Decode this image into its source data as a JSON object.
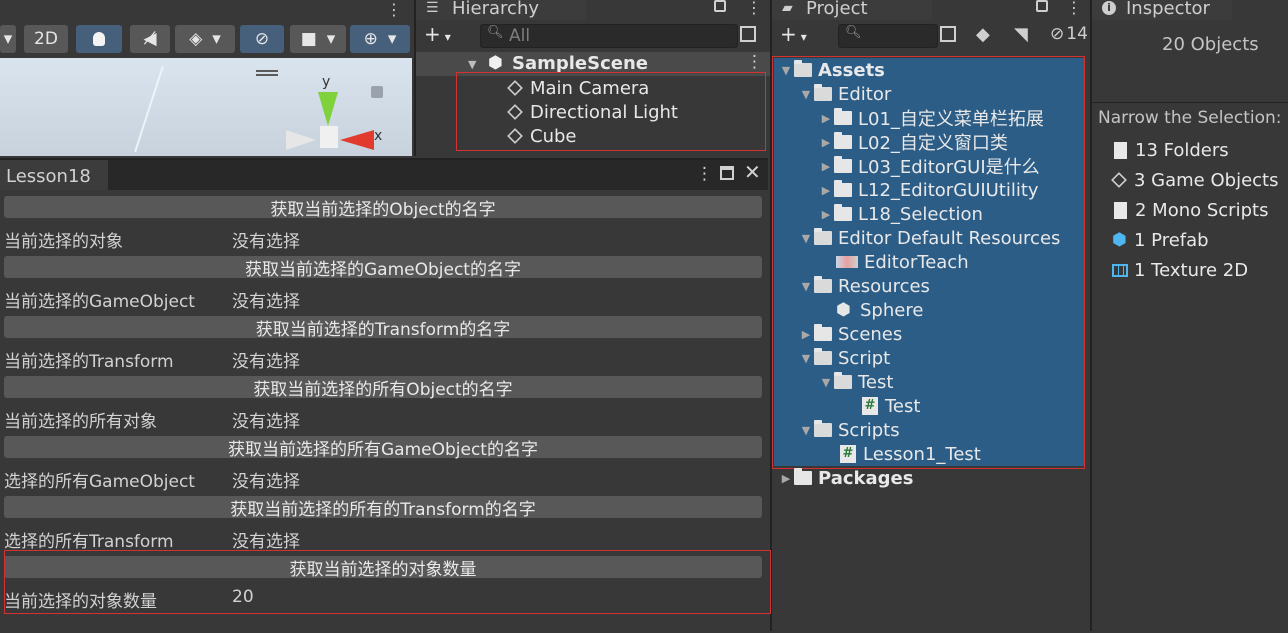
{
  "scene_toolbar": {
    "mode_2d": "2D"
  },
  "gizmo": {
    "y_label": "y",
    "x_label": "x"
  },
  "hierarchy": {
    "tab": "Hierarchy",
    "search_placeholder": "All",
    "scene": "SampleScene",
    "items": [
      "Main Camera",
      "Directional Light",
      "Cube"
    ]
  },
  "project": {
    "tab": "Project",
    "count": "14",
    "tree": [
      {
        "label": "Assets",
        "bold": true
      },
      {
        "label": "Editor"
      },
      {
        "label": "L01_自定义菜单栏拓展"
      },
      {
        "label": "L02_自定义窗口类"
      },
      {
        "label": "L03_EditorGUI是什么"
      },
      {
        "label": "L12_EditorGUIUtility"
      },
      {
        "label": "L18_Selection"
      },
      {
        "label": "Editor Default Resources"
      },
      {
        "label": "EditorTeach"
      },
      {
        "label": "Resources"
      },
      {
        "label": "Sphere"
      },
      {
        "label": "Scenes"
      },
      {
        "label": "Script"
      },
      {
        "label": "Test"
      },
      {
        "label": "Test"
      },
      {
        "label": "Scripts"
      },
      {
        "label": "Lesson1_Test"
      },
      {
        "label": "Packages",
        "bold": true
      }
    ]
  },
  "inspector": {
    "tab": "Inspector",
    "summary": "20 Objects",
    "narrow_label": "Narrow the Selection:",
    "items": [
      "13 Folders",
      "3 Game Objects",
      "2 Mono Scripts",
      "1 Prefab",
      "1 Texture 2D"
    ]
  },
  "lesson": {
    "tab": "Lesson18",
    "rows": [
      {
        "button": "获取当前选择的Object的名字",
        "label": "当前选择的对象",
        "value": "没有选择"
      },
      {
        "button": "获取当前选择的GameObject的名字",
        "label": "当前选择的GameObject",
        "value": "没有选择"
      },
      {
        "button": "获取当前选择的Transform的名字",
        "label": "当前选择的Transform",
        "value": "没有选择"
      },
      {
        "button": "获取当前选择的所有Object的名字",
        "label": "当前选择的所有对象",
        "value": "没有选择"
      },
      {
        "button": "获取当前选择的所有GameObject的名字",
        "label": "选择的所有GameObject",
        "value": "没有选择"
      },
      {
        "button": "获取当前选择的所有的Transform的名字",
        "label": "选择的所有Transform",
        "value": "没有选择"
      },
      {
        "button": "获取当前选择的对象数量",
        "label": "当前选择的对象数量",
        "value": "20"
      }
    ]
  },
  "colors": {
    "selection_bg": "#2c5d87",
    "highlight_border": "#d23232",
    "button_bg": "#585858"
  }
}
